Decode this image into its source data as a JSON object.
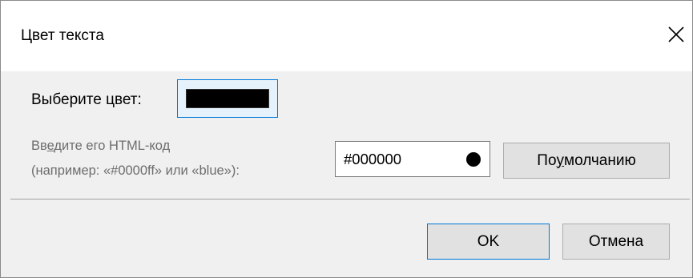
{
  "window": {
    "title": "Цвет текста",
    "close_icon": "close-icon"
  },
  "color_picker": {
    "label": "Выберите цвет:",
    "selected_color": "#000000"
  },
  "html_code": {
    "hint_prefix": "Вв",
    "hint_accel": "е",
    "hint_suffix": "дите его HTML-код",
    "hint_line2": "(например: «#0000ff» или «blue»):",
    "value": "#000000",
    "preview_color": "#000000"
  },
  "buttons": {
    "default_prefix": "По ",
    "default_accel": "у",
    "default_suffix": "молчанию",
    "ok": "OK",
    "cancel": "Отмена"
  }
}
